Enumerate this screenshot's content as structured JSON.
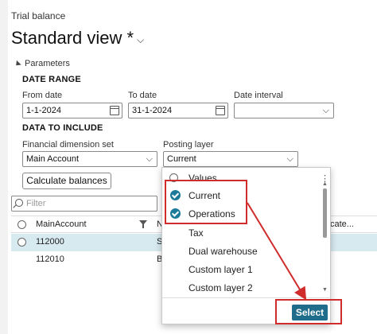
{
  "breadcrumb": "Trial balance",
  "view_title": "Standard view *",
  "parameters_label": "Parameters",
  "date_range": {
    "section": "DATE RANGE",
    "from_label": "From date",
    "from_value": "1-1-2024",
    "to_label": "To date",
    "to_value": "31-1-2024",
    "interval_label": "Date interval",
    "interval_value": ""
  },
  "data_to_include": {
    "section": "DATA TO INCLUDE",
    "dimension_label": "Financial dimension set",
    "dimension_value": "Main Account",
    "posting_label": "Posting layer",
    "posting_value": "Current"
  },
  "calculate_button": "Calculate balances",
  "filter_placeholder": "Filter",
  "grid": {
    "col_main": "MainAccount",
    "col_n": "N",
    "col_cate": "cate...",
    "rows": [
      {
        "account": "112000",
        "name": "S",
        "selected": true
      },
      {
        "account": "112010",
        "name": "B",
        "selected": false
      }
    ]
  },
  "posting_dropdown": {
    "header": "Values",
    "options": [
      {
        "label": "Current",
        "checked": true
      },
      {
        "label": "Operations",
        "checked": true
      },
      {
        "label": "Tax",
        "checked": false
      },
      {
        "label": "Dual warehouse",
        "checked": false
      },
      {
        "label": "Custom layer 1",
        "checked": false
      },
      {
        "label": "Custom layer 2",
        "checked": false
      }
    ],
    "select_button": "Select"
  },
  "colors": {
    "accent": "#1f6d8a",
    "highlight": "#d12c2c",
    "selected_row": "#d7eaf0"
  }
}
